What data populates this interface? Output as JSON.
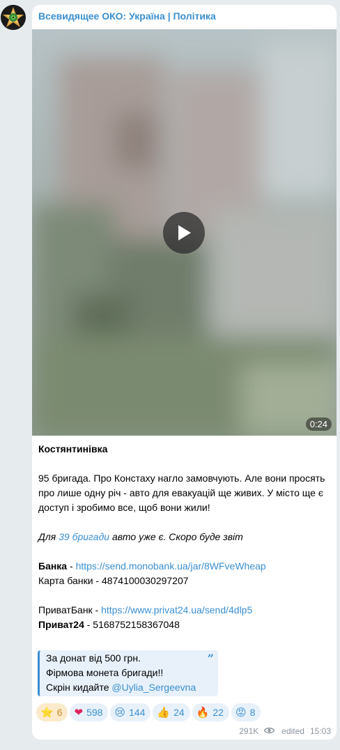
{
  "channel": {
    "name": "Всевидящее ОКО: Україна | Політика"
  },
  "video": {
    "duration": "0:24"
  },
  "post": {
    "title": "Костянтинівка",
    "paragraph1": "95 бригада. Про Констаху нагло замовчують. Але вони просять про лише одну річ - авто для евакуацій ще живих. У місто ще є доступ і зробимо все, щоб вони жили!",
    "para2_prefix": "Для ",
    "para2_link": "39 бригади",
    "para2_suffix": " авто уже є. Скоро буде звіт",
    "bank_label": "Банка",
    "bank_sep": " - ",
    "bank_link": "https://send.monobank.ua/jar/8WFveWheap",
    "card_line": "Карта банки - 4874100030297207",
    "privat_prefix": "ПриватБанк - ",
    "privat_link": "https://www.privat24.ua/send/4dlp5",
    "privat24_label": "Приват24",
    "privat24_value": " - 5168752158367048"
  },
  "quote": {
    "line1": "За донат від 500 грн.",
    "line2": "Фірмова монета бригади!!",
    "line3_prefix": "Скрін кидайте ",
    "line3_mention": "@Uylia_Sergeevna"
  },
  "reactions": [
    {
      "emoji": "⭐",
      "count": "6"
    },
    {
      "emoji": "❤",
      "count": "598"
    },
    {
      "emoji": "😢",
      "count": "144"
    },
    {
      "emoji": "👍",
      "count": "24"
    },
    {
      "emoji": "🔥",
      "count": "22"
    },
    {
      "emoji": "😡",
      "count": "8"
    }
  ],
  "meta": {
    "views": "291K",
    "edited_label": "edited",
    "time": "15:03"
  },
  "colors": {
    "accent": "#3a8fd0",
    "background": "#e6ebee",
    "bubble": "#ffffff"
  }
}
